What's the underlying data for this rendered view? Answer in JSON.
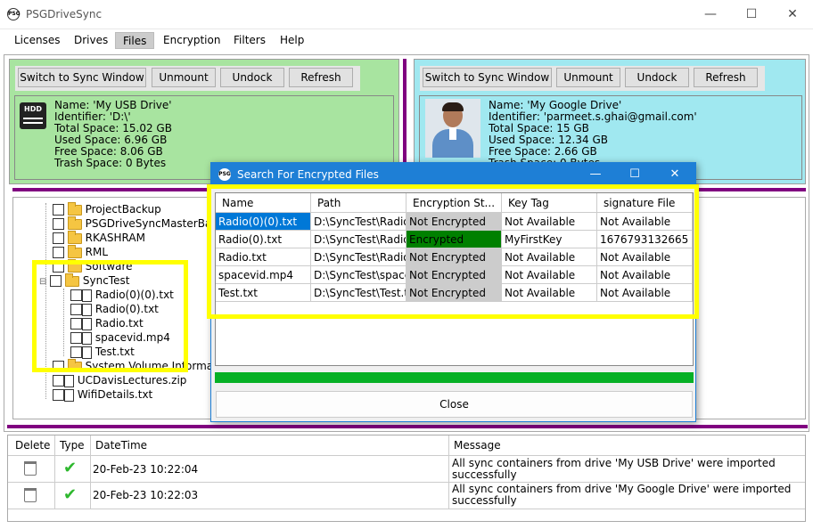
{
  "app": {
    "title": "PSGDriveSync",
    "icon_text": "PSG"
  },
  "window_controls": {
    "minimize": "—",
    "maximize": "☐",
    "close": "✕"
  },
  "menu": [
    "Licenses",
    "Drives",
    "Files",
    "Encryption",
    "Filters",
    "Help"
  ],
  "menu_active": "Files",
  "left_panel": {
    "buttons": [
      "Switch to Sync Window",
      "Unmount",
      "Undock",
      "Refresh"
    ],
    "icon": "hdd-icon",
    "icon_text": "HDD",
    "drive": {
      "name": "Name: 'My USB Drive'",
      "identifier": "Identifier: 'D:\\'",
      "total": "Total Space: 15.02 GB",
      "used": "Used Space: 6.96 GB",
      "free": "Free Space: 8.06 GB",
      "trash": "Trash Space: 0 Bytes"
    },
    "tree": [
      {
        "label": "ProjectBackup",
        "type": "folder"
      },
      {
        "label": "PSGDriveSyncMasterBa",
        "type": "folder"
      },
      {
        "label": "RKASHRAM",
        "type": "folder"
      },
      {
        "label": "RML",
        "type": "folder"
      },
      {
        "label": "Software",
        "type": "folder"
      },
      {
        "label": "SyncTest",
        "type": "folder"
      },
      {
        "label": "Radio(0)(0).txt",
        "type": "file"
      },
      {
        "label": "Radio(0).txt",
        "type": "file"
      },
      {
        "label": "Radio.txt",
        "type": "file"
      },
      {
        "label": "spacevid.mp4",
        "type": "file"
      },
      {
        "label": "Test.txt",
        "type": "file"
      },
      {
        "label": "System Volume Informat",
        "type": "folder"
      },
      {
        "label": "UCDavisLectures.zip",
        "type": "file"
      },
      {
        "label": "WifiDetails.txt",
        "type": "file"
      }
    ],
    "expander": "⊟"
  },
  "right_panel": {
    "buttons": [
      "Switch to Sync Window",
      "Unmount",
      "Undock",
      "Refresh"
    ],
    "icon": "avatar",
    "drive": {
      "name": "Name: 'My Google Drive'",
      "identifier": "Identifier: 'parmeet.s.ghai@gmail.com'",
      "total": "Total Space: 15 GB",
      "used": "Used Space: 12.34 GB",
      "free": "Free Space: 2.66 GB",
      "trash": "Trash Space: 0 Bytes"
    }
  },
  "dialog": {
    "title": "Search For Encrypted Files",
    "columns": [
      "Name",
      "Path",
      "Encryption St...",
      "Key Tag",
      "signature File"
    ],
    "rows": [
      {
        "name": "Radio(0)(0).txt",
        "path": "D:\\SyncTest\\Radio",
        "status": "Not Encrypted",
        "key": "Not Available",
        "sig": "Not Available",
        "selected": true,
        "encrypted": false
      },
      {
        "name": "Radio(0).txt",
        "path": "D:\\SyncTest\\Radio",
        "status": "Encrypted",
        "key": "MyFirstKey",
        "sig": "1676793132665",
        "selected": false,
        "encrypted": true
      },
      {
        "name": "Radio.txt",
        "path": "D:\\SyncTest\\Radio",
        "status": "Not Encrypted",
        "key": "Not Available",
        "sig": "Not Available",
        "selected": false,
        "encrypted": false
      },
      {
        "name": "spacevid.mp4",
        "path": "D:\\SyncTest\\space",
        "status": "Not Encrypted",
        "key": "Not Available",
        "sig": "Not Available",
        "selected": false,
        "encrypted": false
      },
      {
        "name": "Test.txt",
        "path": "D:\\SyncTest\\Test.t",
        "status": "Not Encrypted",
        "key": "Not Available",
        "sig": "Not Available",
        "selected": false,
        "encrypted": false
      }
    ],
    "progress": 1.0,
    "close_button": "Close"
  },
  "log": {
    "columns": [
      "Delete",
      "Type",
      "DateTime",
      "Message"
    ],
    "rows": [
      {
        "datetime": "20-Feb-23 10:22:04",
        "message1": "All sync containers from drive 'My USB Drive' were imported",
        "message2": "successfully"
      },
      {
        "datetime": "20-Feb-23 10:22:03",
        "message1": "All sync containers from drive 'My Google Drive' were imported",
        "message2": "successfully"
      }
    ]
  },
  "colors": {
    "left_panel": "#a8e4a0",
    "right_panel": "#a0e8f0",
    "separator": "#800080",
    "highlight": "#ffff00",
    "encrypted": "#008000",
    "not_encrypted": "#cccccc",
    "selected_row": "#0078d7",
    "progress": "#06b025",
    "dialog_title": "#1e7fd6"
  }
}
